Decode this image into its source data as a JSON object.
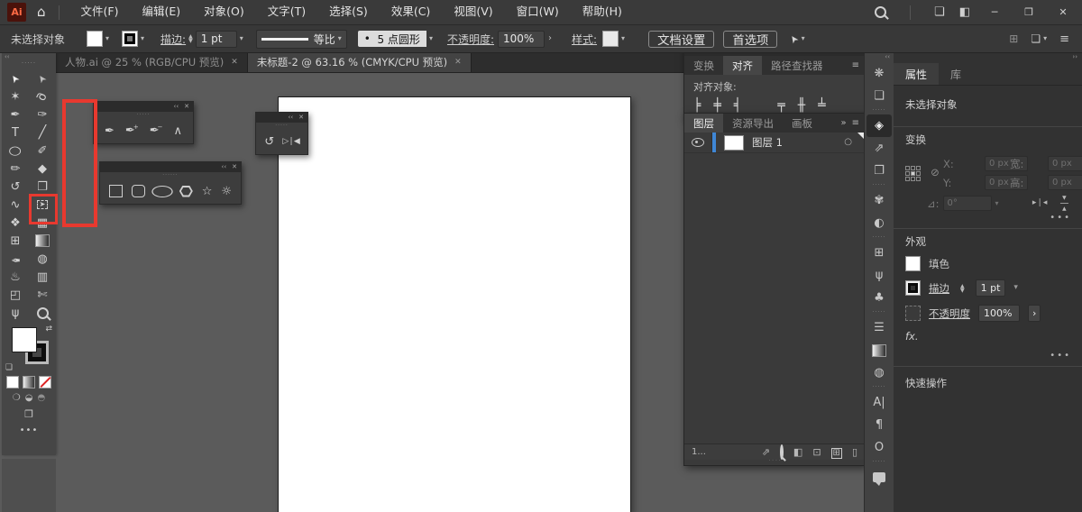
{
  "menubar": {
    "logo_text": "Ai",
    "items": [
      {
        "name": "menu-file",
        "label": "文件(F)"
      },
      {
        "name": "menu-edit",
        "label": "编辑(E)"
      },
      {
        "name": "menu-object",
        "label": "对象(O)"
      },
      {
        "name": "menu-type",
        "label": "文字(T)"
      },
      {
        "name": "menu-select",
        "label": "选择(S)"
      },
      {
        "name": "menu-effect",
        "label": "效果(C)"
      },
      {
        "name": "menu-view",
        "label": "视图(V)"
      },
      {
        "name": "menu-window",
        "label": "窗口(W)"
      },
      {
        "name": "menu-help",
        "label": "帮助(H)"
      }
    ],
    "window_controls": {
      "minimize": "─",
      "maximize": "❒",
      "close": "✕"
    }
  },
  "controlbar": {
    "no_selection_label": "未选择对象",
    "stroke_label": "描边:",
    "stroke_value": "1 pt",
    "profile_value": "等比",
    "brush_bullet": "•",
    "brush_value": "5 点圆形",
    "opacity_label": "不透明度:",
    "opacity_value": "100%",
    "style_label": "样式:",
    "document_setup_label": "文档设置",
    "preferences_label": "首选项"
  },
  "document_tabs": [
    {
      "label": "人物.ai @ 25 % (RGB/CPU 预览)",
      "active": false
    },
    {
      "label": "未标题-2 @ 63.16 % (CMYK/CPU 预览)",
      "active": true
    }
  ],
  "toolbar": {
    "tools": [
      {
        "name": "selection-tool",
        "glyph": "➤"
      },
      {
        "name": "direct-selection-tool",
        "glyph": "➤"
      },
      {
        "name": "magic-wand-tool",
        "glyph": "✶"
      },
      {
        "name": "lasso-tool",
        "glyph": "ϱ"
      },
      {
        "name": "pen-tool",
        "glyph": "✒"
      },
      {
        "name": "curvature-tool",
        "glyph": "✑"
      },
      {
        "name": "type-tool",
        "glyph": "T"
      },
      {
        "name": "line-segment-tool",
        "glyph": "╱"
      },
      {
        "name": "ellipse-tool",
        "glyph": "○"
      },
      {
        "name": "paintbrush-tool",
        "glyph": "✐"
      },
      {
        "name": "shaper-tool",
        "glyph": "✏"
      },
      {
        "name": "eraser-tool",
        "glyph": "◆"
      },
      {
        "name": "rotate-tool",
        "glyph": "↺"
      },
      {
        "name": "scale-tool",
        "glyph": "❐"
      },
      {
        "name": "width-tool",
        "glyph": "∿"
      },
      {
        "name": "free-transform-tool",
        "glyph": "➤",
        "boxed": true
      },
      {
        "name": "shape-builder-tool",
        "glyph": "❖"
      },
      {
        "name": "perspective-grid-tool",
        "glyph": "▦"
      },
      {
        "name": "mesh-tool",
        "glyph": "⊞"
      },
      {
        "name": "gradient-tool",
        "css": "grad"
      },
      {
        "name": "eyedropper-tool",
        "glyph": "✒"
      },
      {
        "name": "blend-tool",
        "glyph": "◍"
      },
      {
        "name": "symbol-sprayer-tool",
        "glyph": "♨"
      },
      {
        "name": "column-graph-tool",
        "glyph": "▥"
      },
      {
        "name": "artboard-tool",
        "glyph": "◰"
      },
      {
        "name": "slice-tool",
        "glyph": "✄"
      },
      {
        "name": "hand-tool",
        "glyph": "ψ"
      },
      {
        "name": "zoom-tool",
        "css": "lens"
      }
    ]
  },
  "tearoffs": {
    "pen_panel": {
      "tools": [
        {
          "name": "pen-tool",
          "glyph": "✒"
        },
        {
          "name": "add-anchor-point-tool",
          "glyph": "✒",
          "badge": "+"
        },
        {
          "name": "delete-anchor-point-tool",
          "glyph": "✒",
          "badge": "−"
        },
        {
          "name": "anchor-point-tool",
          "glyph": "∧"
        }
      ]
    },
    "rotate_panel": {
      "tools": [
        {
          "name": "rotate-tool",
          "glyph": "↺"
        },
        {
          "name": "reflect-tool",
          "glyph": "▷❘◀"
        }
      ]
    },
    "shape_panel": {
      "tools": [
        {
          "name": "rectangle-tool",
          "css": "shp-rect"
        },
        {
          "name": "rounded-rectangle-tool",
          "css": "shp-round"
        },
        {
          "name": "ellipse-tool",
          "css": "shp-ell"
        },
        {
          "name": "polygon-tool",
          "css": "shp-hex"
        },
        {
          "name": "star-tool",
          "glyph": "☆"
        },
        {
          "name": "flare-tool",
          "glyph": "☼"
        }
      ]
    }
  },
  "align_panel": {
    "tabs": [
      {
        "name": "tab-transform",
        "label": "变换",
        "active": false
      },
      {
        "name": "tab-align",
        "label": "对齐",
        "active": true
      },
      {
        "name": "tab-pathfinder",
        "label": "路径查找器",
        "active": false
      }
    ],
    "align_objects_label": "对齐对象:",
    "buttons": [
      {
        "name": "align-left",
        "glyph": "╞"
      },
      {
        "name": "align-h-center",
        "glyph": "╪"
      },
      {
        "name": "align-right",
        "glyph": "╡"
      },
      {
        "name": "align-top",
        "glyph": "╤"
      },
      {
        "name": "align-v-center",
        "glyph": "╫"
      },
      {
        "name": "align-bottom",
        "glyph": "╧"
      }
    ]
  },
  "layers_panel": {
    "tabs": [
      {
        "name": "tab-layers",
        "label": "图层",
        "active": true
      },
      {
        "name": "tab-asset-export",
        "label": "资源导出",
        "active": false
      },
      {
        "name": "tab-artboards",
        "label": "画板",
        "active": false
      }
    ],
    "layer": {
      "label": "图层 1"
    },
    "status": "1...",
    "bottom_buttons": [
      {
        "name": "collect-for-export",
        "glyph": "⇗"
      },
      {
        "name": "locate-object",
        "css": "lens-sm"
      },
      {
        "name": "make-clipping-mask",
        "glyph": "◧"
      },
      {
        "name": "new-sublayer",
        "glyph": "⊡"
      },
      {
        "name": "new-layer",
        "glyph": "⊞",
        "boxed": true
      },
      {
        "name": "delete-selection",
        "glyph": "▯"
      }
    ]
  },
  "dock": {
    "groups": [
      [
        {
          "name": "color-icon",
          "glyph": "❋"
        },
        {
          "name": "color-guide-icon",
          "glyph": "❏"
        }
      ],
      [
        {
          "name": "layers-icon",
          "glyph": "◈",
          "active": true
        },
        {
          "name": "asset-export-icon",
          "glyph": "⇗"
        },
        {
          "name": "artboards-icon",
          "glyph": "❐"
        }
      ],
      [
        {
          "name": "palette-icon",
          "glyph": "✾"
        },
        {
          "name": "gradient-wedge-icon",
          "glyph": "◐"
        }
      ],
      [
        {
          "name": "pattern-icon",
          "glyph": "⊞"
        },
        {
          "name": "brushes-icon",
          "glyph": "ψ"
        },
        {
          "name": "symbols-icon",
          "glyph": "♣"
        }
      ],
      [
        {
          "name": "stroke-icon",
          "glyph": "☰"
        },
        {
          "name": "gradient-icon",
          "css": "grad"
        },
        {
          "name": "transparency-icon",
          "glyph": "◍"
        }
      ],
      [
        {
          "name": "character-icon",
          "glyph": "A|"
        },
        {
          "name": "paragraph-icon",
          "glyph": "¶"
        },
        {
          "name": "opentype-icon",
          "glyph": "O"
        }
      ],
      [
        {
          "name": "comments-icon",
          "css": "bubble"
        }
      ]
    ]
  },
  "properties_panel": {
    "tabs": [
      {
        "name": "tab-properties",
        "label": "属性",
        "active": true
      },
      {
        "name": "tab-libraries",
        "label": "库",
        "active": false
      }
    ],
    "no_selection_label": "未选择对象",
    "transform": {
      "title": "变换",
      "x_label": "X:",
      "x_value": "0 px",
      "y_label": "Y:",
      "y_value": "0 px",
      "w_label": "宽:",
      "w_value": "0 px",
      "h_label": "高:",
      "h_value": "0 px",
      "angle_label": "⊿:",
      "angle_value": "0°"
    },
    "appearance": {
      "title": "外观",
      "fill_label": "填色",
      "stroke_label": "描边",
      "stroke_value": "1 pt",
      "opacity_label": "不透明度",
      "opacity_value": "100%",
      "fx_label": "fx."
    },
    "quick_actions_title": "快速操作"
  },
  "colors": {
    "accent_blue": "#3f87d6",
    "annotation_red": "#e8392f",
    "canvas": "#5b5b5b",
    "artboard": "#ffffff"
  }
}
